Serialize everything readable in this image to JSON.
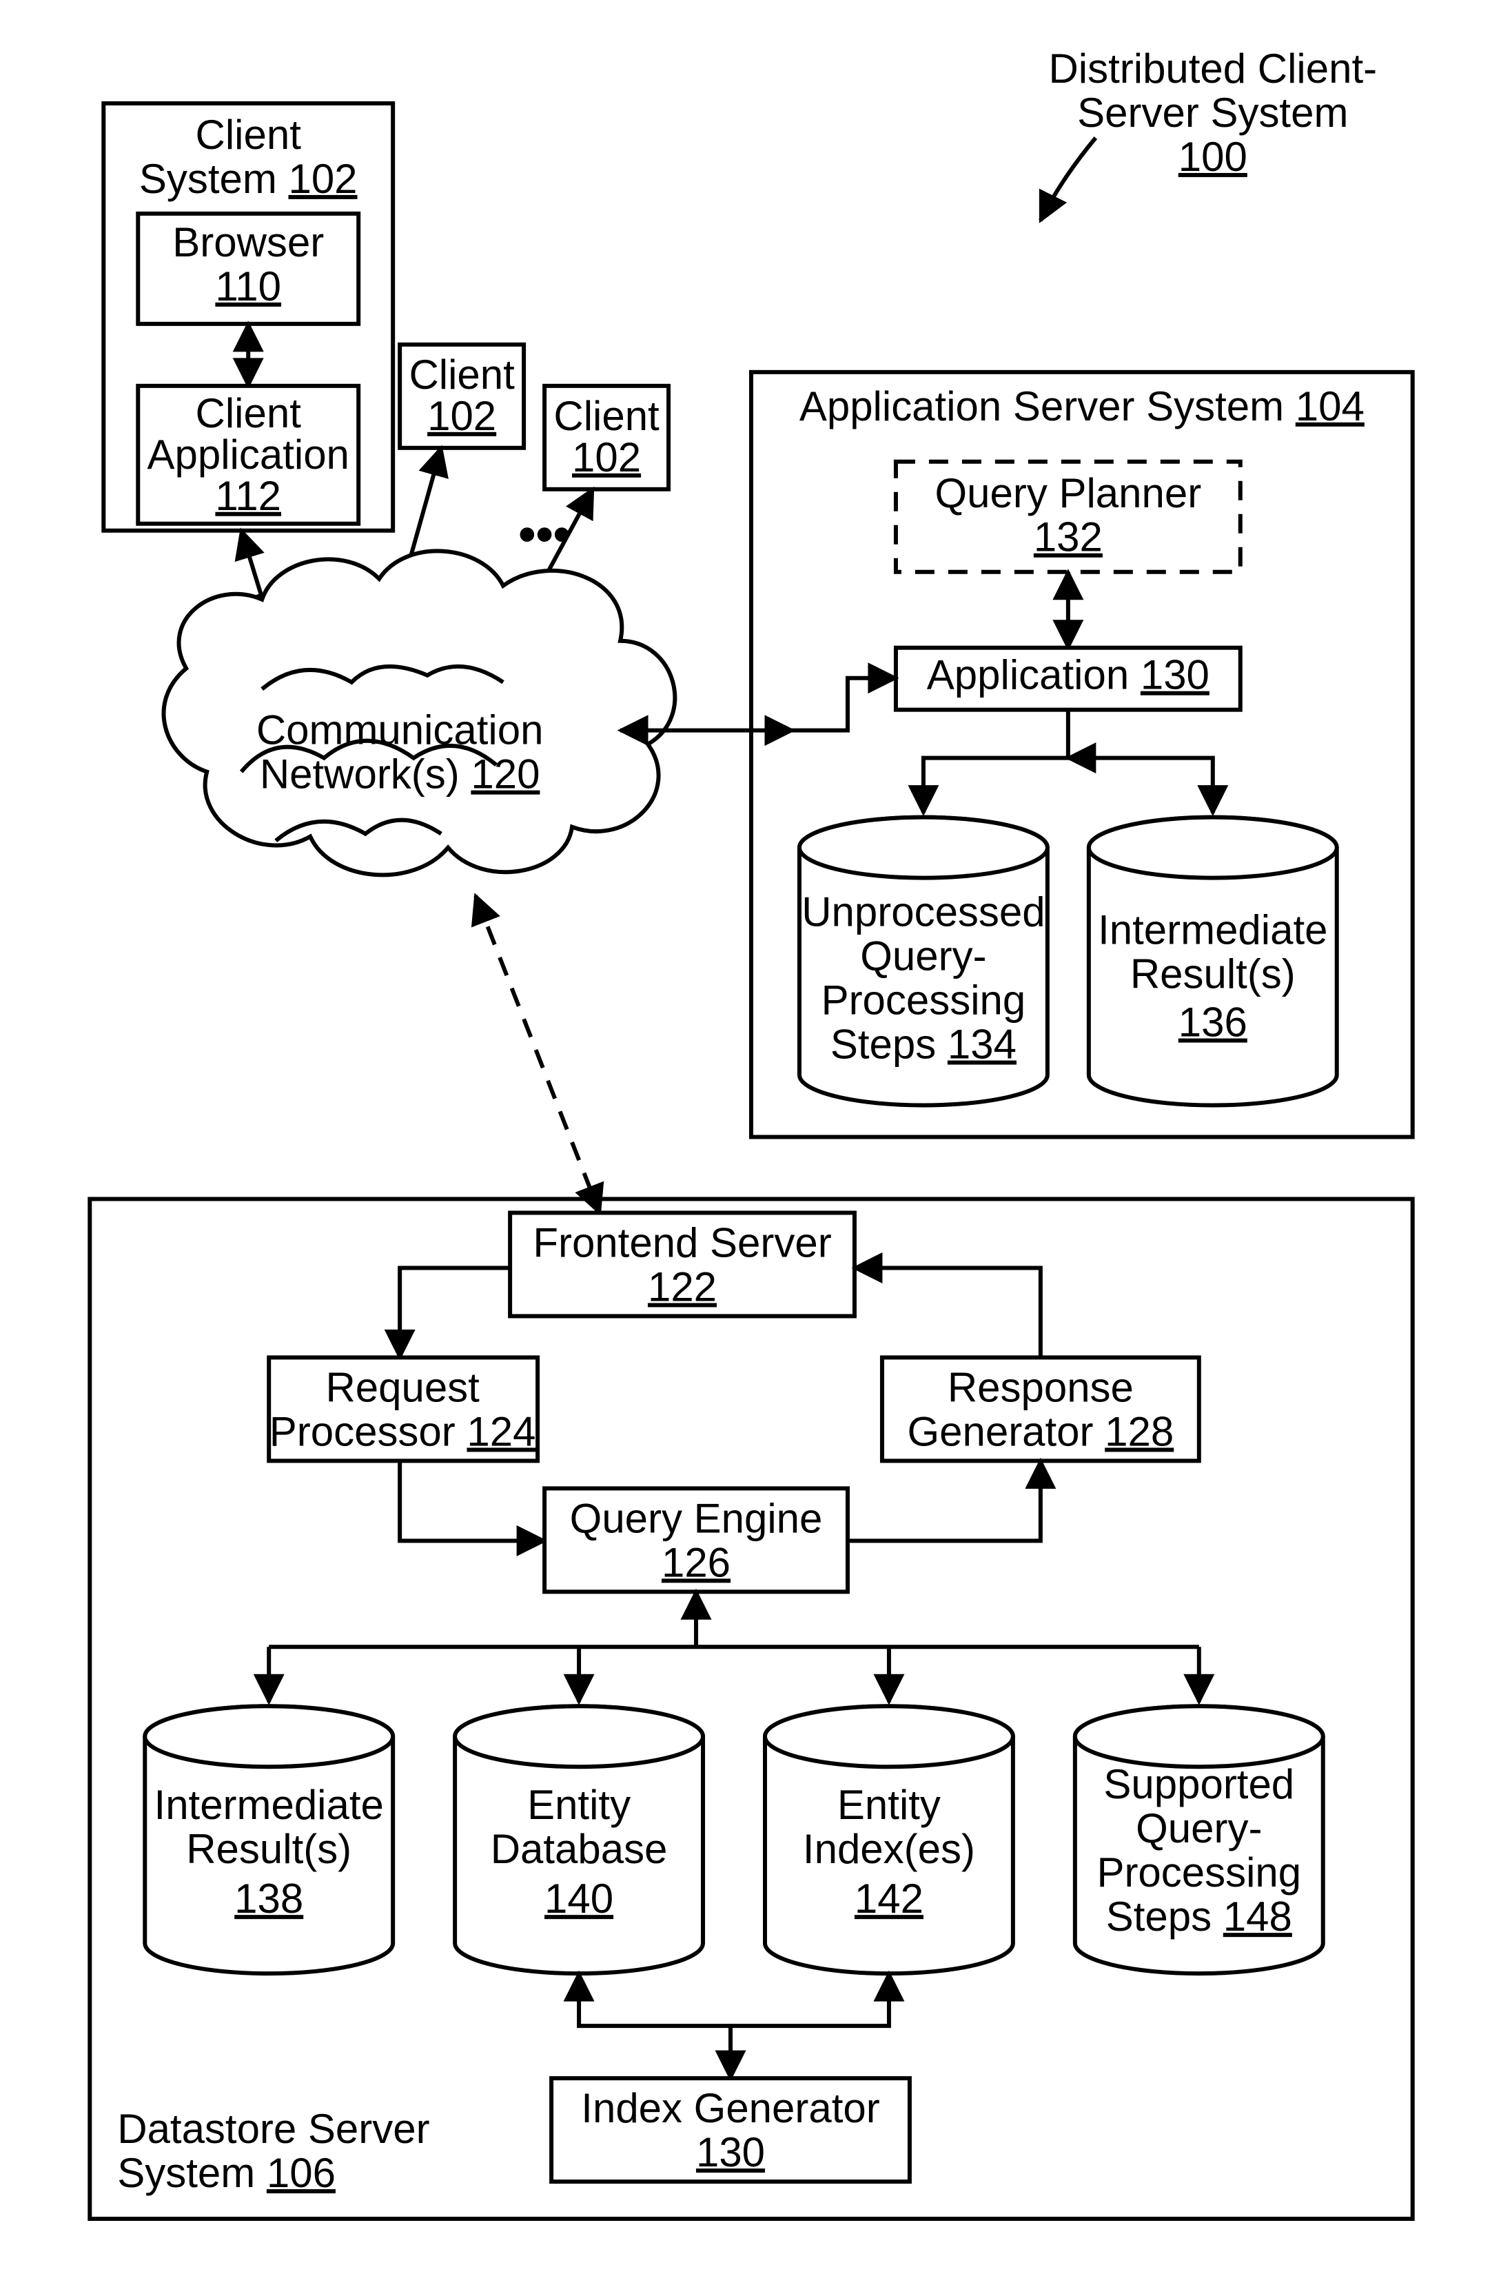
{
  "title": {
    "l1": "Distributed Client-",
    "l2": "Server System",
    "num": "100"
  },
  "clientSystem": {
    "l1": "Client",
    "l2": "System",
    "num": "102"
  },
  "browser": {
    "l1": "Browser",
    "num": "110"
  },
  "clientApp": {
    "l1": "Client",
    "l2": "Application",
    "num": "112"
  },
  "client2": {
    "l1": "Client",
    "num": "102"
  },
  "client3": {
    "l1": "Client",
    "num": "102"
  },
  "dots": "•••",
  "network": {
    "l1": "Communication",
    "l2": "Network(s)",
    "num": "120"
  },
  "appServer": {
    "l1": "Application Server System",
    "num": "104"
  },
  "queryPlanner": {
    "l1": "Query Planner",
    "num": "132"
  },
  "application": {
    "l1": "Application",
    "num": "130"
  },
  "unprocessed": {
    "l1": "Unprocessed",
    "l2": "Query-",
    "l3": "Processing",
    "l4": "Steps",
    "num": "134"
  },
  "intermAS": {
    "l1": "Intermediate",
    "l2": "Result(s)",
    "num": "136"
  },
  "datastore": {
    "l1": "Datastore Server",
    "l2": "System",
    "num": "106"
  },
  "frontend": {
    "l1": "Frontend Server",
    "num": "122"
  },
  "reqproc": {
    "l1": "Request",
    "l2": "Processor",
    "num": "124"
  },
  "respgen": {
    "l1": "Response",
    "l2": "Generator",
    "num": "128"
  },
  "qengine": {
    "l1": "Query Engine",
    "num": "126"
  },
  "intermDS": {
    "l1": "Intermediate",
    "l2": "Result(s)",
    "num": "138"
  },
  "entitydb": {
    "l1": "Entity",
    "l2": "Database",
    "num": "140"
  },
  "entityidx": {
    "l1": "Entity",
    "l2": "Index(es)",
    "num": "142"
  },
  "supported": {
    "l1": "Supported",
    "l2": "Query-",
    "l3": "Processing",
    "l4": "Steps",
    "num": "148"
  },
  "indexgen": {
    "l1": "Index Generator",
    "num": "130"
  }
}
